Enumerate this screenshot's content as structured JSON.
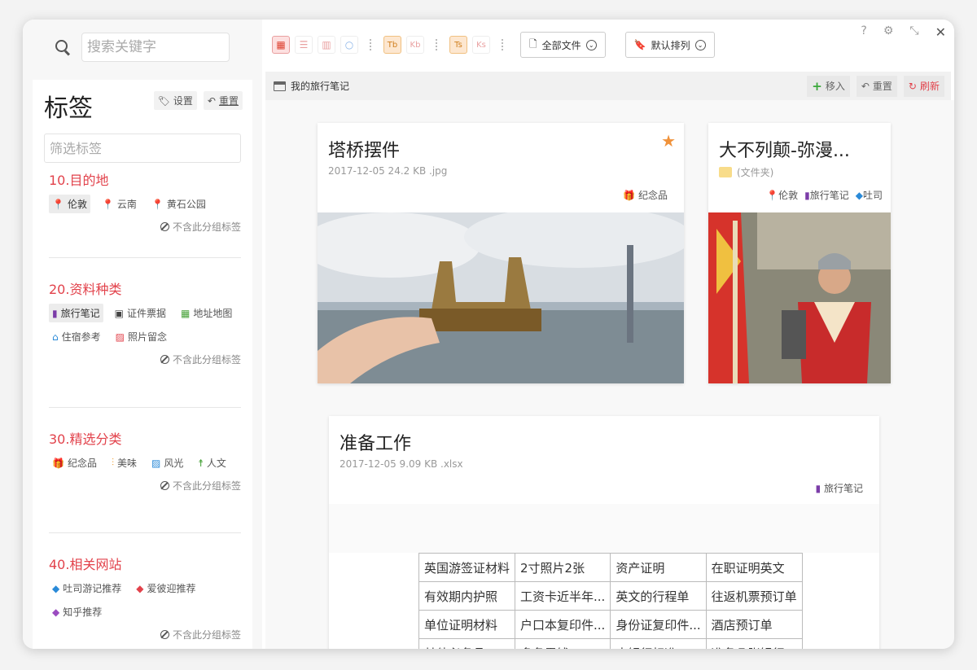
{
  "search": {
    "placeholder": "搜索关键字"
  },
  "tags": {
    "title": "标签",
    "settings_label": "设置",
    "reset_label": "重置",
    "filter_placeholder": "筛选标签",
    "exclude_label": "不含此分组标签",
    "groups": [
      {
        "title": "10.目的地",
        "chips": [
          {
            "label": "伦敦",
            "icon": "pin-icon",
            "color": "#e2424b",
            "selected": true
          },
          {
            "label": "云南",
            "icon": "pin-icon",
            "color": "#2a8ad8",
            "selected": false
          },
          {
            "label": "黄石公园",
            "icon": "pin-icon",
            "color": "#f0a23a",
            "selected": false
          }
        ]
      },
      {
        "title": "20.资料种类",
        "chips": [
          {
            "label": "旅行笔记",
            "icon": "notebook-icon",
            "color": "#7b3ca8",
            "selected": true
          },
          {
            "label": "证件票据",
            "icon": "id-card-icon",
            "color": "#444",
            "selected": false
          },
          {
            "label": "地址地图",
            "icon": "map-icon",
            "color": "#4aa33c",
            "selected": false
          },
          {
            "label": "住宿参考",
            "icon": "home-icon",
            "color": "#2a8ad8",
            "selected": false
          },
          {
            "label": "照片留念",
            "icon": "photo-icon",
            "color": "#e2424b",
            "selected": false
          }
        ]
      },
      {
        "title": "30.精选分类",
        "chips": [
          {
            "label": "纪念品",
            "icon": "gift-icon",
            "color": "#444",
            "selected": false
          },
          {
            "label": "美味",
            "icon": "cutlery-icon",
            "color": "#f0a23a",
            "selected": false
          },
          {
            "label": "风光",
            "icon": "landscape-icon",
            "color": "#2a8ad8",
            "selected": false
          },
          {
            "label": "人文",
            "icon": "person-icon",
            "color": "#4aa33c",
            "selected": false
          }
        ]
      },
      {
        "title": "40.相关网站",
        "chips": [
          {
            "label": "吐司游记推荐",
            "icon": "tag-icon",
            "color": "#2a8ad8",
            "selected": false
          },
          {
            "label": "爱彼迎推荐",
            "icon": "tag-icon",
            "color": "#e2424b",
            "selected": false
          },
          {
            "label": "知乎推荐",
            "icon": "tag-icon",
            "color": "#9b4cc0",
            "selected": false
          }
        ]
      }
    ]
  },
  "toolbar": {
    "filter_label": "全部文件",
    "sort_label": "默认排列",
    "window_controls": [
      "?",
      "gear",
      "shrink",
      "close"
    ]
  },
  "crumb": {
    "path": "我的旅行笔记",
    "move_label": "移入",
    "reset_label": "重置",
    "refresh_label": "刷新"
  },
  "cards": [
    {
      "title": "塔桥摆件",
      "meta": "2017-12-05  24.2 KB  .jpg",
      "tags": [
        {
          "label": "纪念品",
          "icon": "gift-icon",
          "color": "#444"
        }
      ],
      "starred": true
    },
    {
      "title": "大不列颠-弥漫...",
      "meta": "(文件夹)",
      "tags": [
        {
          "label": "伦敦",
          "icon": "pin-icon",
          "color": "#e2424b"
        },
        {
          "label": "旅行笔记",
          "icon": "notebook-icon",
          "color": "#7b3ca8"
        },
        {
          "label": "吐司",
          "icon": "tag-icon",
          "color": "#2a8ad8"
        }
      ]
    },
    {
      "title": "准备工作",
      "meta": "2017-12-05  9.09 KB  .xlsx",
      "tags": [
        {
          "label": "旅行笔记",
          "icon": "notebook-icon",
          "color": "#7b3ca8"
        }
      ]
    }
  ],
  "sheet": [
    [
      "英国游签证材料",
      "2寸照片2张",
      "资产证明",
      "在职证明英文"
    ],
    [
      "有效期内护照",
      "工资卡近半年...",
      "英文的行程单",
      "往返机票预订单"
    ],
    [
      "单位证明材料",
      "户口本复印件...",
      "身份证复印件...",
      "酒店预订单"
    ],
    [
      "其他必备品：",
      "多备零钱",
      "水银行标准...",
      "准备几张银行..."
    ]
  ]
}
